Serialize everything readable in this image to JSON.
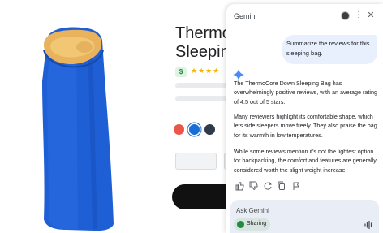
{
  "product": {
    "title_line1": "Thermo",
    "title_line2": "Sleepin",
    "price_badge": "$",
    "rating_stars": "★★★★",
    "swatches": [
      "#e8574a",
      "#1a6fd6",
      "#2f3a4a"
    ]
  },
  "gemini": {
    "title": "Gemini",
    "header_icons": {
      "avatar": "avatar",
      "more": "more-vert-icon",
      "close": "close-icon"
    },
    "user_prompt": "Summarize the reviews for this sleeping bag.",
    "response": {
      "para1": "The ThermoCore Down Sleeping Bag has overwhelmingly positive reviews, with an average rating of 4.5 out of 5 stars.",
      "para2": "Many reviewers highlight its comfortable shape, which lets side sleepers move freely. They also praise the bag for its warmth in low temperatures.",
      "para3": "While some reviews mention it's not the lightest option for backpacking, the comfort and features are generally considered worth the slight weight increase."
    },
    "actions": [
      "thumbs-up-icon",
      "thumbs-down-icon",
      "regenerate-icon",
      "copy-icon",
      "flag-icon"
    ],
    "input": {
      "placeholder": "Ask Gemini",
      "sharing_label": "Sharing"
    }
  },
  "colors": {
    "bag": "#1f5fd6",
    "bag_hood": "#e9b25c",
    "gemini_accent": "#4a8af4",
    "user_bubble": "#e8f0fe"
  }
}
